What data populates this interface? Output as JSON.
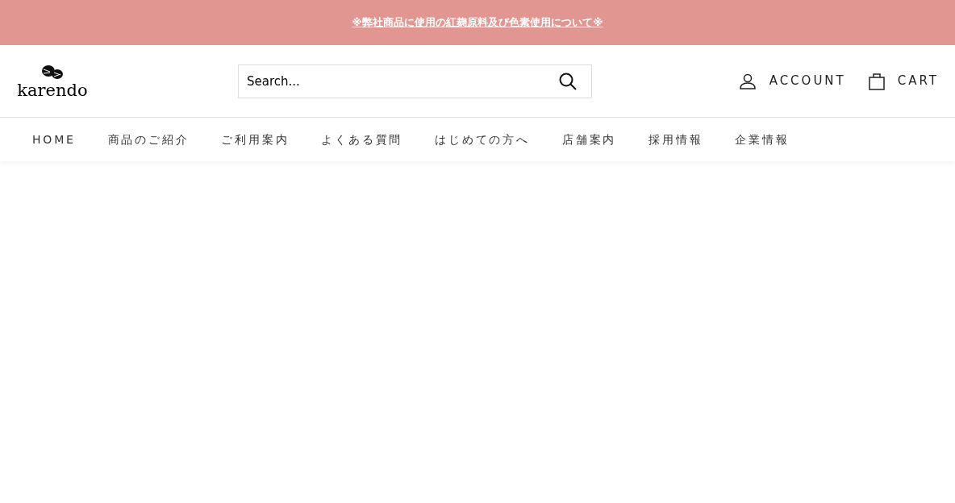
{
  "announcement": {
    "text": "※弊社商品に使用の紅麹原料及び色素使用について※"
  },
  "header": {
    "logo": {
      "text": "karendo"
    },
    "search": {
      "placeholder": "Search..."
    },
    "account": {
      "label": "ACCOUNT"
    },
    "cart": {
      "label": "CART"
    }
  },
  "nav": {
    "items": [
      {
        "label": "HOME"
      },
      {
        "label": "商品のご紹介"
      },
      {
        "label": "ご利用案内"
      },
      {
        "label": "よくある質問"
      },
      {
        "label": "はじめての方へ"
      },
      {
        "label": "店舗案内"
      },
      {
        "label": "採用情報"
      },
      {
        "label": "企業情報"
      }
    ]
  }
}
